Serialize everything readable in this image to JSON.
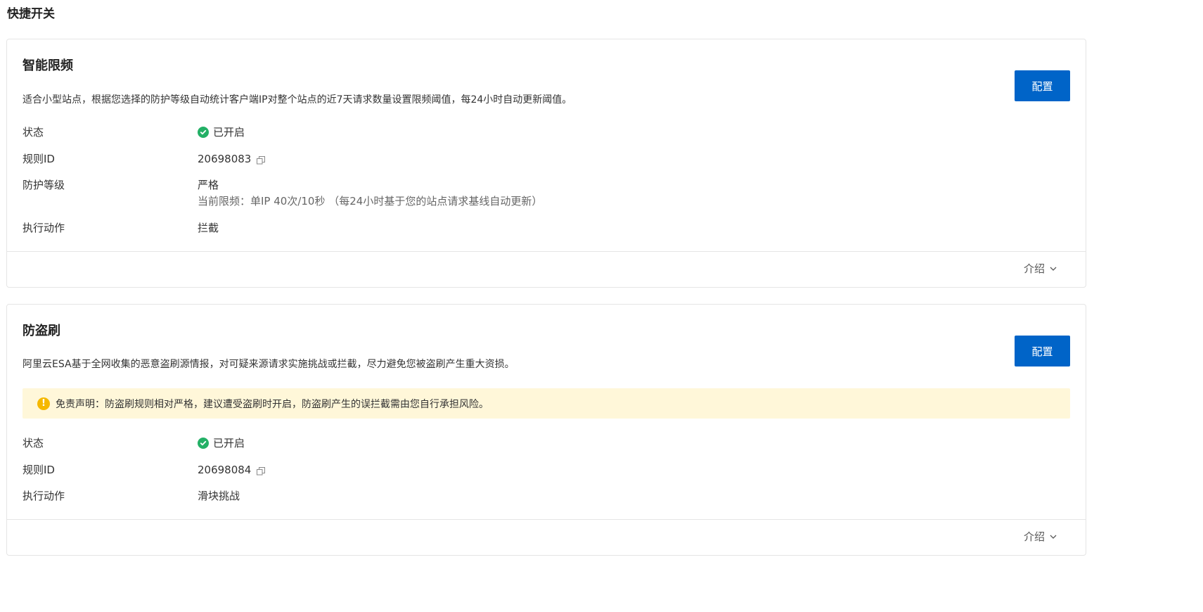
{
  "page": {
    "title": "快捷开关"
  },
  "cards": [
    {
      "title": "智能限频",
      "description": "适合小型站点，根据您选择的防护等级自动统计客户端IP对整个站点的近7天请求数量设置限频阈值，每24小时自动更新阈值。",
      "config_label": "配置",
      "rows": {
        "status": {
          "label": "状态",
          "value": "已开启"
        },
        "rule_id": {
          "label": "规则ID",
          "value": "20698083"
        },
        "protection_level": {
          "label": "防护等级",
          "value": "严格",
          "sub": "当前限频：单IP 40次/10秒 （每24小时基于您的站点请求基线自动更新）"
        },
        "action": {
          "label": "执行动作",
          "value": "拦截"
        }
      },
      "intro_label": "介绍"
    },
    {
      "title": "防盗刷",
      "description": "阿里云ESA基于全网收集的恶意盗刷源情报，对可疑来源请求实施挑战或拦截，尽力避免您被盗刷产生重大资损。",
      "config_label": "配置",
      "notice": "免责声明：防盗刷规则相对严格，建议遭受盗刷时开启，防盗刷产生的误拦截需由您自行承担风险。",
      "rows": {
        "status": {
          "label": "状态",
          "value": "已开启"
        },
        "rule_id": {
          "label": "规则ID",
          "value": "20698084"
        },
        "action": {
          "label": "执行动作",
          "value": "滑块挑战"
        }
      },
      "intro_label": "介绍"
    }
  ],
  "colors": {
    "primary": "#0064c8",
    "success": "#23b066",
    "warning": "#f5b800",
    "notice_bg": "#fff7d9"
  },
  "icons": {
    "status": "check-circle-icon",
    "copy": "copy-icon",
    "expand": "chevron-down-icon",
    "warning": "warning-icon"
  }
}
